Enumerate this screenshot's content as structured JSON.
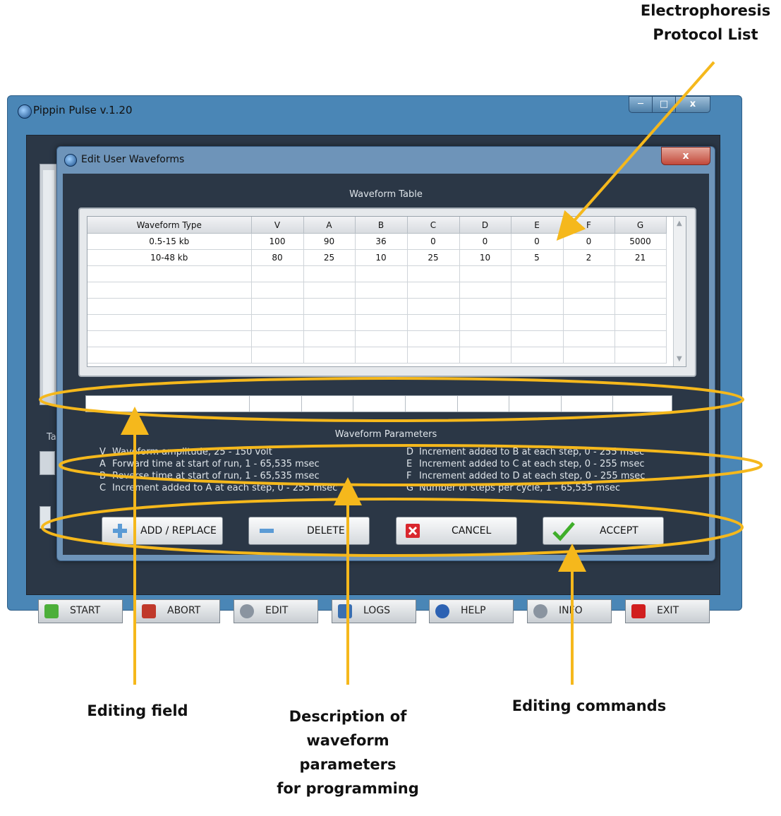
{
  "callouts": {
    "protocol_list": [
      "Electrophoresis",
      "Protocol List"
    ],
    "editing_field": "Editing field",
    "description": [
      "Description of",
      "waveform",
      "parameters",
      "for programming"
    ],
    "editing_commands": "Editing commands"
  },
  "main_window": {
    "title": "Pippin Pulse v.1.20",
    "close_glyph": "x",
    "side_label": "Ta",
    "buttons": [
      {
        "label": "START",
        "icon": "start-arrow-icon",
        "color": "#4caf3a"
      },
      {
        "label": "ABORT",
        "icon": "abort-x-icon",
        "color": "#c0392b"
      },
      {
        "label": "EDIT",
        "icon": "gear-icon",
        "color": "#8a94a0"
      },
      {
        "label": "LOGS",
        "icon": "log-book-icon",
        "color": "#3a6fb0"
      },
      {
        "label": "HELP",
        "icon": "help-icon",
        "color": "#2d62b3"
      },
      {
        "label": "INFO",
        "icon": "magnifier-icon",
        "color": "#8a94a0"
      },
      {
        "label": "EXIT",
        "icon": "exit-square-icon",
        "color": "#d11f1f"
      }
    ]
  },
  "dialog": {
    "title": "Edit User Waveforms",
    "close_glyph": "x",
    "table_heading": "Waveform Table",
    "columns": [
      "Waveform Type",
      "V",
      "A",
      "B",
      "C",
      "D",
      "E",
      "F",
      "G"
    ],
    "rows": [
      [
        "0.5-15 kb",
        "100",
        "90",
        "36",
        "0",
        "0",
        "0",
        "0",
        "5000"
      ],
      [
        "10-48 kb",
        "80",
        "25",
        "10",
        "25",
        "10",
        "5",
        "2",
        "21"
      ]
    ],
    "param_heading": "Waveform Parameters",
    "params_left": [
      {
        "key": "V",
        "text": "Waveform amplitude, 25 - 150 volt"
      },
      {
        "key": "A",
        "text": "Forward time at start of run, 1 - 65,535 msec"
      },
      {
        "key": "B",
        "text": "Reverse time at start of run, 1 - 65,535 msec"
      },
      {
        "key": "C",
        "text": "Increment added to A at each step, 0 - 255 msec"
      }
    ],
    "params_right": [
      {
        "key": "D",
        "text": "Increment added to B at each step, 0 - 255 msec"
      },
      {
        "key": "E",
        "text": "Increment added to C at each step, 0 - 255 msec"
      },
      {
        "key": "F",
        "text": "Increment added to D at each step, 0 - 255 msec"
      },
      {
        "key": "G",
        "text": "Number of steps per cycle, 1 - 65,535 msec"
      }
    ],
    "buttons": {
      "add_replace": "ADD / REPLACE",
      "delete": "DELETE",
      "cancel": "CANCEL",
      "accept": "ACCEPT"
    }
  },
  "colors": {
    "annotation": "#f5b81c",
    "dialog_bg": "#2b3746",
    "window_frame": "#4a86b6"
  }
}
